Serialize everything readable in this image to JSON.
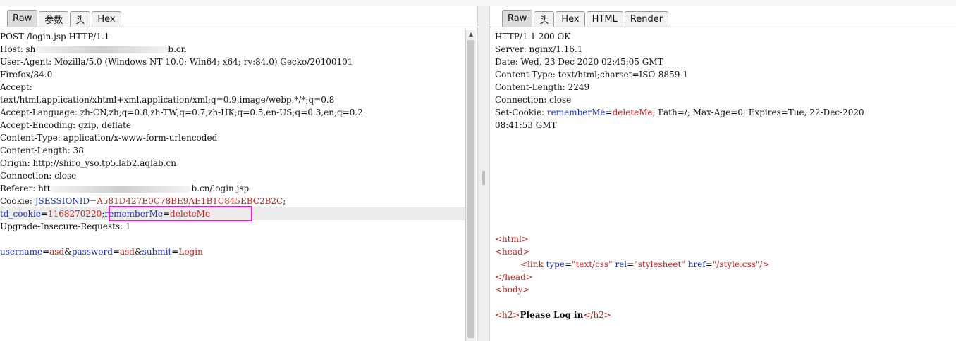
{
  "request": {
    "tabs": [
      "Raw",
      "参数",
      "头",
      "Hex"
    ],
    "lines": {
      "l0": "POST /login.jsp HTTP/1.1",
      "l1a": "Host: sh",
      "l1b": "b.cn",
      "l2": "User-Agent: Mozilla/5.0 (Windows NT 10.0; Win64; x64; rv:84.0) Gecko/20100101",
      "l3": "Firefox/84.0",
      "l4": "Accept:",
      "l5": "text/html,application/xhtml+xml,application/xml;q=0.9,image/webp,*/*;q=0.8",
      "l6": "Accept-Language: zh-CN,zh;q=0.8,zh-TW;q=0.7,zh-HK;q=0.5,en-US;q=0.3,en;q=0.2",
      "l7": "Accept-Encoding: gzip, deflate",
      "l8": "Content-Type: application/x-www-form-urlencoded",
      "l9": "Content-Length: 38",
      "l10": "Origin: http://shiro_yso.tp5.lab2.aqlab.cn",
      "l11": "Connection: close",
      "l12a": "Referer: htt",
      "l12b": "b.cn/login.jsp",
      "l13_key": "Cookie: ",
      "l13_name": "JSESSIONID",
      "l13_eq": "=",
      "l13_val": "A581D427E0C78BE9AE1B1C845EBC2B2C",
      "l13_end": ";",
      "l14_name": "td_cookie",
      "l14_eq": "=",
      "l14_val": "1168270220",
      "l14_sep": ";",
      "l14_name2": "rememberMe",
      "l14_eq2": "=",
      "l14_val2": "deleteMe",
      "l15": "Upgrade-Insecure-Requests: 1",
      "body_k1": "username",
      "body_v1": "asd",
      "body_k2": "password",
      "body_v2": "asd",
      "body_k3": "submit",
      "body_v3": "Login",
      "eq": "=",
      "amp": "&"
    }
  },
  "response": {
    "tabs": [
      "Raw",
      "头",
      "Hex",
      "HTML",
      "Render"
    ],
    "lines": {
      "r0": "HTTP/1.1 200 OK",
      "r1": "Server: nginx/1.16.1",
      "r2": "Date: Wed, 23 Dec 2020 02:45:05 GMT",
      "r3": "Content-Type: text/html;charset=ISO-8859-1",
      "r4": "Content-Length: 2249",
      "r5": "Connection: close",
      "r6_key": "Set-Cookie: ",
      "r6_name": "rememberMe",
      "r6_eq": "=",
      "r6_val": "deleteMe",
      "r6_rest": "; Path=/; Max-Age=0; Expires=Tue, 22-Dec-2020",
      "r7": "08:41:53 GMT",
      "h_html": "<html>",
      "h_head": "<head>",
      "h_link_open": "<link ",
      "h_type": "type",
      "h_type_val": "\"text/css\"",
      "h_rel": "rel",
      "h_rel_val": "\"stylesheet\"",
      "h_href": "href",
      "h_href_val": "\"/style.css\"",
      "h_link_close": "/>",
      "h_head_close": "</head>",
      "h_body": "<body>",
      "h2_open": "<h2>",
      "h2_text": "Please Log in",
      "h2_close": "</h2>"
    }
  },
  "colors": {
    "accent_highlight": "#e01ad6",
    "key_blue": "#1a2bb8",
    "value_red": "#c32020"
  }
}
